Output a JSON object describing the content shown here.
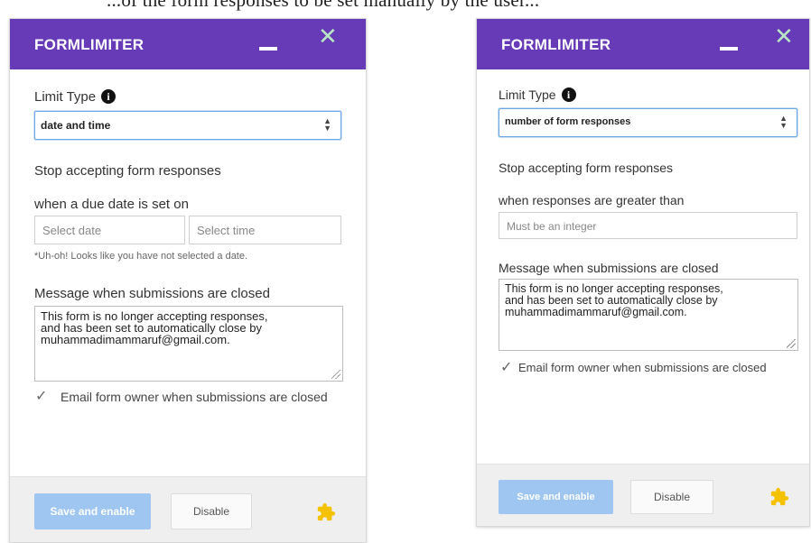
{
  "caption_fragment": "...of the form responses to be set manually by the user...",
  "colors": {
    "header": "#673ab7",
    "primary_button": "#9fc6f0",
    "select_focus": "#6aa7e8",
    "puzzle_icon": "#f5c200"
  },
  "panel_left": {
    "title": "FORMLIMITER",
    "limit_type_label": "Limit Type",
    "limit_type_value": "date and time",
    "stop_label": "Stop accepting form responses",
    "condition_label": "when a due date is set on",
    "date_placeholder": "Select date",
    "time_placeholder": "Select time",
    "error_text": "*Uh-oh! Looks like you have not selected a date.",
    "message_label": "Message when submissions are closed",
    "message_text": "This form is no longer accepting responses,\nand has been set to automatically close by\nmuhammadimammaruf@gmail.com.",
    "email_checkbox_checked": true,
    "email_label": "Email form owner when submissions are closed",
    "save_label": "Save and enable",
    "disable_label": "Disable"
  },
  "panel_right": {
    "title": "FORMLIMITER",
    "limit_type_label": "Limit Type",
    "limit_type_value": "number of form responses",
    "stop_label": "Stop accepting form responses",
    "condition_label": "when responses are greater than",
    "integer_placeholder": "Must be an integer",
    "message_label": "Message when submissions are closed",
    "message_text": "This form is no longer accepting responses,\nand has been set to automatically close by\nmuhammadimammaruf@gmail.com.",
    "email_checkbox_checked": true,
    "email_label": "Email form owner when submissions are closed",
    "save_label": "Save and enable",
    "disable_label": "Disable"
  }
}
